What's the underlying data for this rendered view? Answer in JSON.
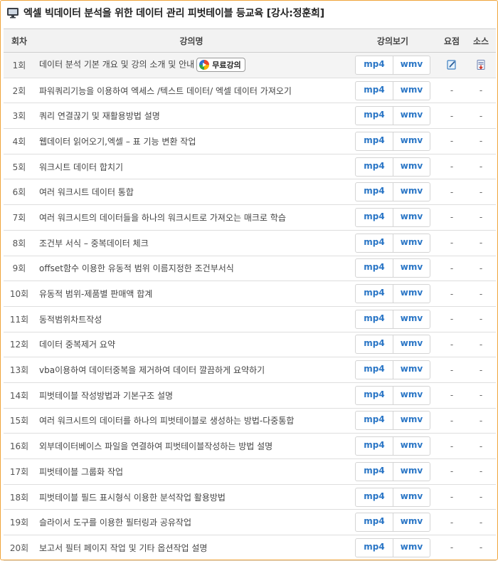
{
  "title": "엑셀 빅데이터 분석을 위한 데이터 관리 피벗테이블 등교육 [강사:정훈희]",
  "headers": {
    "no": "회차",
    "title": "강의명",
    "view": "강의보기",
    "summary": "요점",
    "source": "소스"
  },
  "buttons": {
    "mp4": "mp4",
    "wmv": "wmv"
  },
  "free_badge": "무료강의",
  "dash": "-",
  "lectures": [
    {
      "no": "1회",
      "title": "데이터 분석 기본 개요 및 강의 소개 및 안내"
    },
    {
      "no": "2회",
      "title": "파워쿼리기능을 이용하여 엑세스 /텍스트 데이터/ 엑셀 데이터 가져오기"
    },
    {
      "no": "3회",
      "title": "쿼리 연결끊기 및 재활용방법 설명"
    },
    {
      "no": "4회",
      "title": "웹데이터 읽어오기,엑셀 – 표 기능 변환 작업"
    },
    {
      "no": "5회",
      "title": "워크시트 데이터 합치기"
    },
    {
      "no": "6회",
      "title": "여러 워크시트 데이터 통합"
    },
    {
      "no": "7회",
      "title": "여러 워크시트의 데이터들을 하나의 워크시트로 가져오는 매크로 학습"
    },
    {
      "no": "8회",
      "title": "조건부 서식 – 중복데이터 체크"
    },
    {
      "no": "9회",
      "title": "offset함수 이용한 유동적 범위 이름지정한 조건부서식"
    },
    {
      "no": "10회",
      "title": "유동적 범위-제품별 판매액 합계"
    },
    {
      "no": "11회",
      "title": "동적범위차트작성"
    },
    {
      "no": "12회",
      "title": "데이터 중복제거 요약"
    },
    {
      "no": "13회",
      "title": "vba이용하여 데이터중복을 제거하여 데이터 깔끔하게 요약하기"
    },
    {
      "no": "14회",
      "title": "피벗테이블 작성방법과 기본구조 설명"
    },
    {
      "no": "15회",
      "title": "여러 워크시트의 데이터를 하나의 피벗테이블로 생성하는 방법-다중통합"
    },
    {
      "no": "16회",
      "title": "외부데이터베이스 파일을 연결하여 피벗테이블작성하는 방법 설명"
    },
    {
      "no": "17회",
      "title": "피벗테이블 그룹화 작업"
    },
    {
      "no": "18회",
      "title": "피벗테이블 필드 표시형식 이용한 분석작업 활용방법"
    },
    {
      "no": "19회",
      "title": "슬라이서 도구를 이용한 필터링과 공유작업"
    },
    {
      "no": "20회",
      "title": "보고서 필터 페이지 작업 및 기타 옵션작업 설명"
    }
  ],
  "icons": {
    "title": "monitor-icon",
    "summary": "memo-icon",
    "source": "download-file-icon"
  }
}
